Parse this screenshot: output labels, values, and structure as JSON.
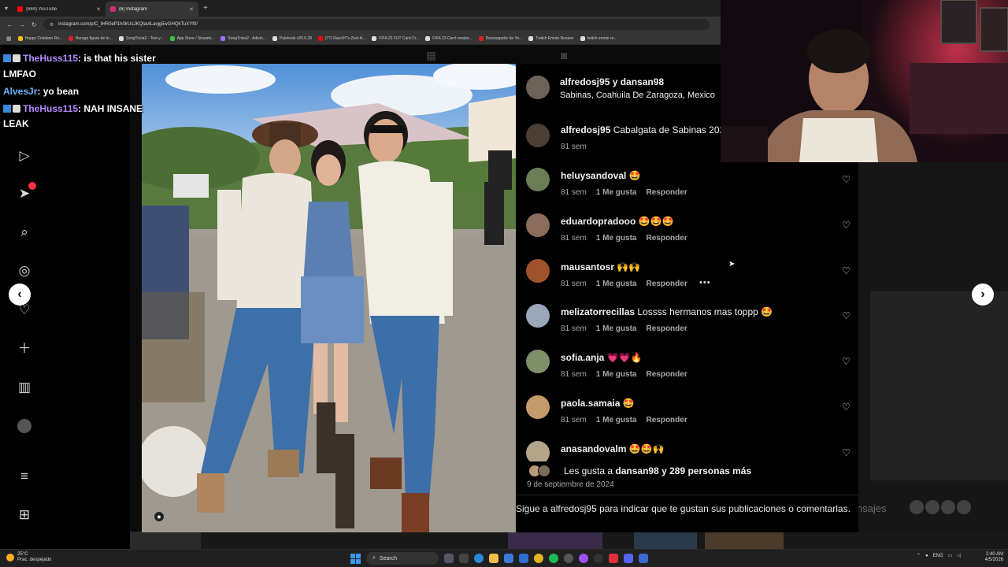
{
  "browser": {
    "tabs": [
      {
        "title": "(684) YouTube",
        "color": "#ff0000"
      },
      {
        "title": "(6) Instagram",
        "color": "#d62976"
      }
    ],
    "new_tab": "+",
    "url": "instagram.com/p/C_tHR0eP1h0lrUsJKQIavtLavjg5ivGHQkTuXYf0/",
    "bookmarks": [
      {
        "label": "Happy Cristiano Ro...",
        "color": "#f2c400"
      },
      {
        "label": "Burago figura de to...",
        "color": "#e02020"
      },
      {
        "label": "SongTrivia2 - Test y...",
        "color": "#dddddd"
      },
      {
        "label": "App Store / Streami...",
        "color": "#40c040"
      },
      {
        "label": "SongTrivia2 - Adivin...",
        "color": "#a070ff"
      },
      {
        "label": "Paletools v26.0.28",
        "color": "#dddddd"
      },
      {
        "label": "(77) Razo97's Zest-A...",
        "color": "#ff0000"
      },
      {
        "label": "FIFA 23 FUT Card Cr...",
        "color": "#dddddd"
      },
      {
        "label": "FIFA 23 Card creator...",
        "color": "#dddddd"
      },
      {
        "label": "Descargador de Yo...",
        "color": "#e02020"
      },
      {
        "label": "Twitch Emote Resizer",
        "color": "#dddddd"
      },
      {
        "label": "twitch emote re...",
        "color": "#dddddd"
      }
    ]
  },
  "chat": [
    {
      "user": "TheHuss115",
      "text": ": is that his sister"
    },
    {
      "user": "",
      "text": "LMFAO"
    },
    {
      "user": "AlvesJr",
      "text": ": yo bean"
    },
    {
      "user": "TheHuss115",
      "text": ": NAH INSANE"
    },
    {
      "user": "",
      "text": "LEAK"
    }
  ],
  "post": {
    "authors": "alfredosj95 y dansan98",
    "location": "Sabinas, Coahuila De Zaragoza, Mexico",
    "caption": {
      "user": "alfredosj95",
      "text": "Cabalgata de Sabinas 2024",
      "time": "81 sem"
    },
    "comments": [
      {
        "user": "heluysandoval",
        "text": "🤩",
        "time": "81 sem",
        "likes": "1 Me gusta",
        "reply": "Responder",
        "avatar": "#6a7d55"
      },
      {
        "user": "eduardopradooo",
        "text": "🤩🤩🤩",
        "time": "81 sem",
        "likes": "1 Me gusta",
        "reply": "Responder",
        "avatar": "#8a6d5a"
      },
      {
        "user": "mausantosr",
        "text": "🙌🙌",
        "time": "81 sem",
        "likes": "1 Me gusta",
        "reply": "Responder",
        "avatar": "#a0522d"
      },
      {
        "user": "melizatorrecillas",
        "text": "Lossss hermanos mas toppp 🤩",
        "time": "81 sem",
        "likes": "1 Me gusta",
        "reply": "Responder",
        "avatar": "#9aa7b8"
      },
      {
        "user": "sofia.anja",
        "text": "💗💗🔥",
        "time": "81 sem",
        "likes": "1 Me gusta",
        "reply": "Responder",
        "avatar": "#7e8f6a"
      },
      {
        "user": "paola.samaia",
        "text": "🤩",
        "time": "81 sem",
        "likes": "1 Me gusta",
        "reply": "Responder",
        "avatar": "#c49a6c"
      },
      {
        "user": "anasandovalm",
        "text": "🤩🤩🙌",
        "time": "",
        "likes": "",
        "reply": "",
        "avatar": "#b3a48a"
      }
    ],
    "likes_text_prefix": "Les gusta a ",
    "likes_user": "dansan98",
    "likes_text_suffix": " y 289 personas más",
    "date": "9 de septiembre de 2024",
    "follow_prompt": "Sigue a alfredosj95 para indicar que te gustan sus publicaciones o comentarlas."
  },
  "messages_label": "nsajes",
  "taskbar": {
    "weather_temp": "25°C",
    "weather_desc": "Prac. despejado",
    "search": "Search",
    "lang": "ENG",
    "time": "2:40 AM",
    "date": "4/5/2026"
  },
  "colors": {
    "instagram_bg": "#000000",
    "accent_blue": "#0095f6"
  }
}
